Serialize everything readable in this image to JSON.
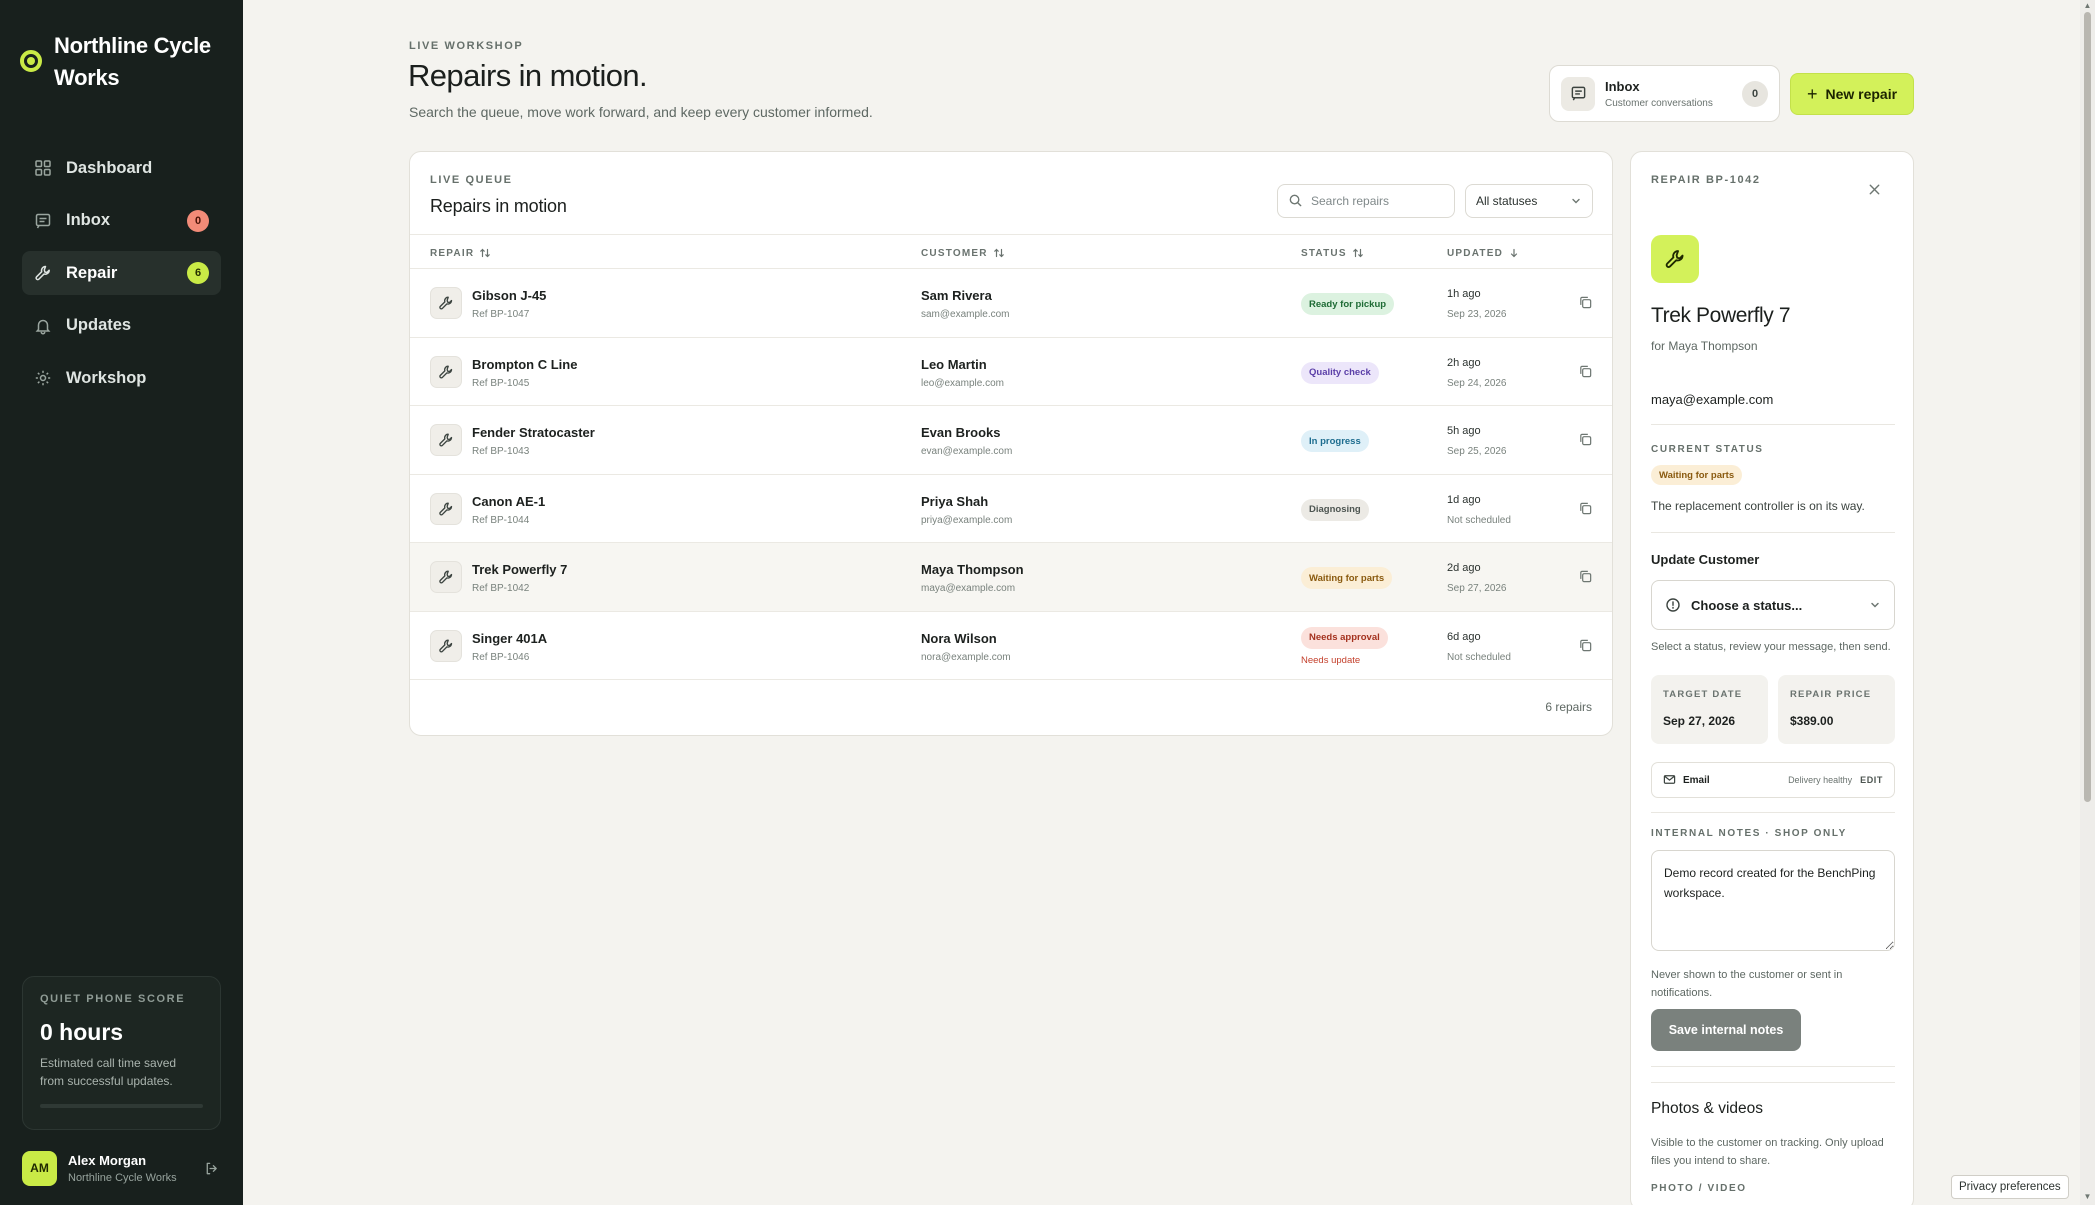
{
  "brand": {
    "name": "Northline Cycle Works",
    "accent": "#c9ea46"
  },
  "sidebar": {
    "items": [
      {
        "label": "Dashboard",
        "icon": "dashboard-icon",
        "badge": ""
      },
      {
        "label": "Inbox",
        "icon": "inbox-icon",
        "badge": "0"
      },
      {
        "label": "Repair",
        "icon": "wrench-icon",
        "badge": "6"
      },
      {
        "label": "Updates",
        "icon": "bell-icon",
        "badge": ""
      },
      {
        "label": "Workshop",
        "icon": "gear-icon",
        "badge": ""
      }
    ],
    "active": "Repair",
    "score": {
      "eyebrow": "QUIET PHONE SCORE",
      "value": "0 hours",
      "description": "Estimated call time saved from successful updates.",
      "progress": 0
    },
    "user": {
      "initials": "AM",
      "name": "Alex Morgan",
      "org": "Northline Cycle Works"
    }
  },
  "header": {
    "eyebrow": "LIVE WORKSHOP",
    "title": "Repairs in motion.",
    "subtitle": "Search the queue, move work forward, and keep every customer informed.",
    "inbox": {
      "title": "Inbox",
      "subtitle": "Customer conversations",
      "count": "0"
    },
    "new_repair": "New repair"
  },
  "queue": {
    "eyebrow": "LIVE QUEUE",
    "title": "Repairs in motion",
    "search_placeholder": "Search repairs",
    "status_filter": "All statuses",
    "columns": {
      "repair": "REPAIR",
      "customer": "CUSTOMER",
      "status": "STATUS",
      "updated": "UPDATED"
    },
    "rows": [
      {
        "name": "Gibson J-45",
        "ref": "Ref BP-1047",
        "customer": "Sam Rivera",
        "email": "sam@example.com",
        "status": "Ready for pickup",
        "status_tone": "green",
        "status_note": "",
        "updated": "1h ago",
        "date": "Sep 23, 2026"
      },
      {
        "name": "Brompton C Line",
        "ref": "Ref BP-1045",
        "customer": "Leo Martin",
        "email": "leo@example.com",
        "status": "Quality check",
        "status_tone": "purple",
        "status_note": "",
        "updated": "2h ago",
        "date": "Sep 24, 2026"
      },
      {
        "name": "Fender Stratocaster",
        "ref": "Ref BP-1043",
        "customer": "Evan Brooks",
        "email": "evan@example.com",
        "status": "In progress",
        "status_tone": "blue",
        "status_note": "",
        "updated": "5h ago",
        "date": "Sep 25, 2026"
      },
      {
        "name": "Canon AE-1",
        "ref": "Ref BP-1044",
        "customer": "Priya Shah",
        "email": "priya@example.com",
        "status": "Diagnosing",
        "status_tone": "gray",
        "status_note": "",
        "updated": "1d ago",
        "date": "Not scheduled"
      },
      {
        "name": "Trek Powerfly 7",
        "ref": "Ref BP-1042",
        "customer": "Maya Thompson",
        "email": "maya@example.com",
        "status": "Waiting for parts",
        "status_tone": "amber",
        "status_note": "",
        "updated": "2d ago",
        "date": "Sep 27, 2026"
      },
      {
        "name": "Singer 401A",
        "ref": "Ref BP-1046",
        "customer": "Nora Wilson",
        "email": "nora@example.com",
        "status": "Needs approval",
        "status_tone": "red",
        "status_note": "Needs update",
        "updated": "6d ago",
        "date": "Not scheduled"
      }
    ],
    "selected_index": 4,
    "count_label": "6 repairs"
  },
  "detail": {
    "eyebrow": "REPAIR BP-1042",
    "title": "Trek Powerfly 7",
    "for_label": "for Maya Thompson",
    "email": "maya@example.com",
    "status_eyebrow": "CURRENT STATUS",
    "status": "Waiting for parts",
    "status_note": "The replacement controller is on its way.",
    "update_title": "Update Customer",
    "choose_placeholder": "Choose a status...",
    "choose_helper": "Select a status, review your message, then send.",
    "target_label": "TARGET DATE",
    "target_value": "Sep 27, 2026",
    "price_label": "REPAIR PRICE",
    "price_value": "$389.00",
    "channel": {
      "label": "Email",
      "health": "Delivery healthy",
      "edit": "EDIT"
    },
    "notes_eyebrow": "INTERNAL NOTES · SHOP ONLY",
    "notes_value": "Demo record created for the BenchPing workspace.",
    "notes_helper": "Never shown to the customer or sent in notifications.",
    "save_label": "Save internal notes",
    "photos_title": "Photos & videos",
    "photos_helper": "Visible to the customer on tracking. Only upload files you intend to share.",
    "photo_eyebrow": "PHOTO / VIDEO"
  },
  "privacy": "Privacy preferences"
}
